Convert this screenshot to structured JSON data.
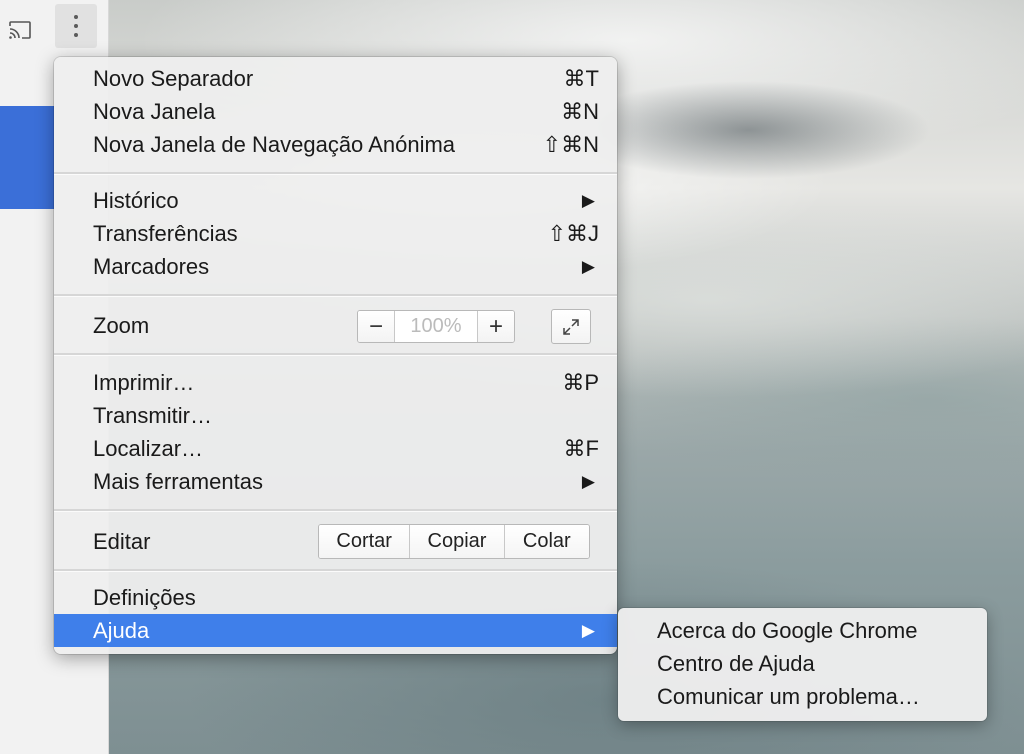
{
  "toolbar": {
    "cast_icon": "cast-icon",
    "more_icon": "vertical-dots-icon"
  },
  "menu": {
    "new_tab": {
      "label": "Novo Separador",
      "shortcut": "⌘T"
    },
    "new_window": {
      "label": "Nova Janela",
      "shortcut": "⌘N"
    },
    "incognito": {
      "label": "Nova Janela de Navegação Anónima",
      "shortcut": "⇧⌘N"
    },
    "history": {
      "label": "Histórico",
      "arrow": "▶"
    },
    "downloads": {
      "label": "Transferências",
      "shortcut": "⇧⌘J"
    },
    "bookmarks": {
      "label": "Marcadores",
      "arrow": "▶"
    },
    "zoom": {
      "label": "Zoom",
      "minus": "−",
      "value": "100%",
      "plus": "+"
    },
    "print": {
      "label": "Imprimir…",
      "shortcut": "⌘P"
    },
    "cast": {
      "label": "Transmitir…"
    },
    "find": {
      "label": "Localizar…",
      "shortcut": "⌘F"
    },
    "more_tools": {
      "label": "Mais ferramentas",
      "arrow": "▶"
    },
    "edit": {
      "label": "Editar",
      "cut": "Cortar",
      "copy": "Copiar",
      "paste": "Colar"
    },
    "settings": {
      "label": "Definições"
    },
    "help": {
      "label": "Ajuda",
      "arrow": "▶"
    }
  },
  "submenu": {
    "about": "Acerca do Google Chrome",
    "help_center": "Centro de Ajuda",
    "report_issue": "Comunicar um problema…"
  },
  "colors": {
    "highlight": "#3f7fea",
    "blue_block": "#3b6fd8"
  }
}
